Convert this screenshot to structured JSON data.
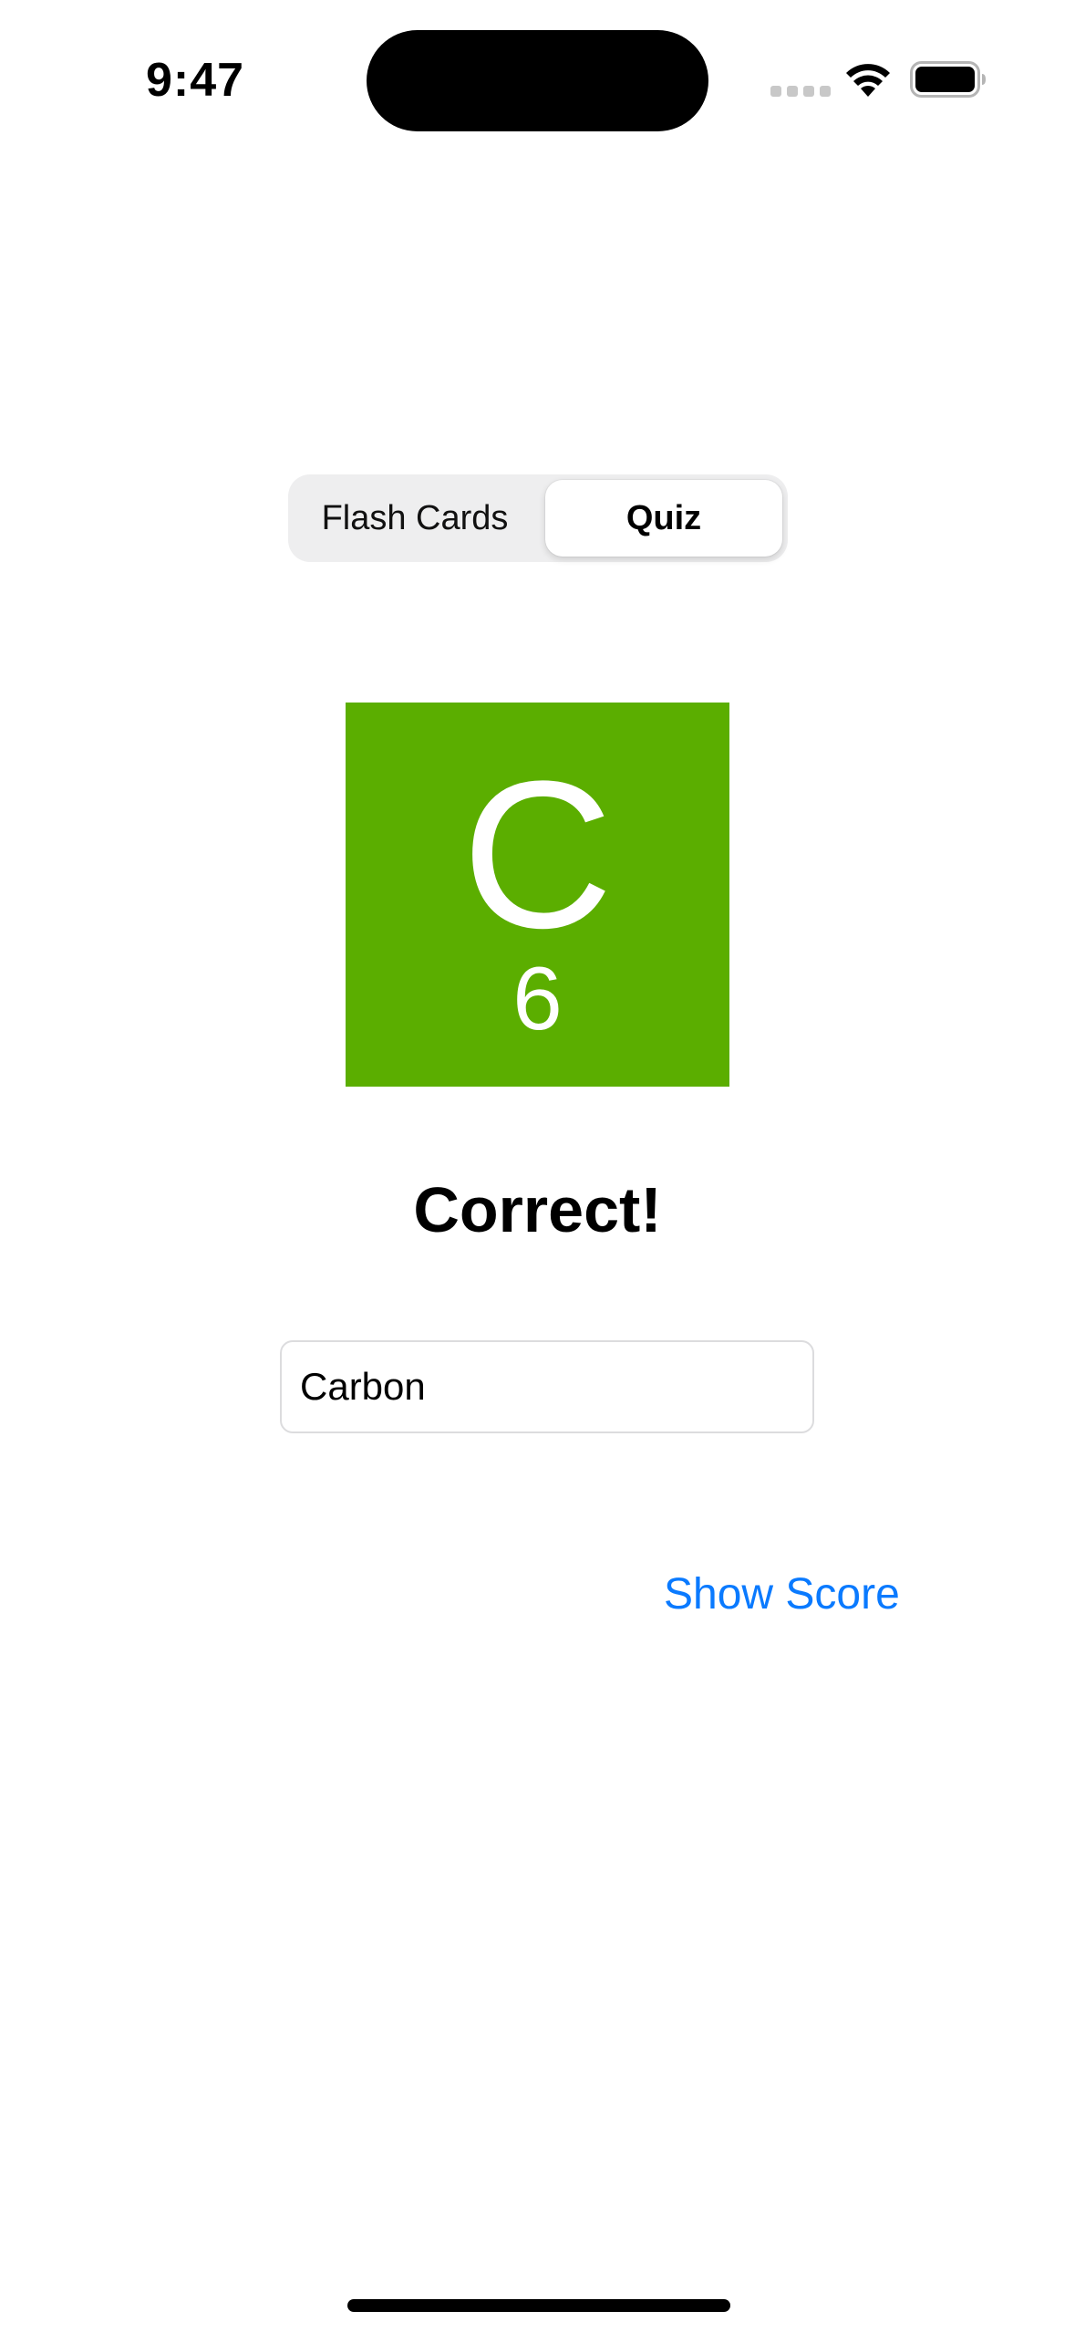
{
  "status_bar": {
    "time": "9:47",
    "icons": [
      "cellular-icon",
      "wifi-icon",
      "battery-icon"
    ]
  },
  "segmented_control": {
    "segments": [
      "Flash Cards",
      "Quiz"
    ],
    "selected": "Quiz"
  },
  "element_card": {
    "symbol": "C",
    "atomic_number": "6",
    "color": "#5bae00"
  },
  "result_text": "Correct!",
  "answer_field": {
    "value": "Carbon"
  },
  "show_score_button": {
    "label": "Show Score",
    "color": "#0a7aff"
  }
}
